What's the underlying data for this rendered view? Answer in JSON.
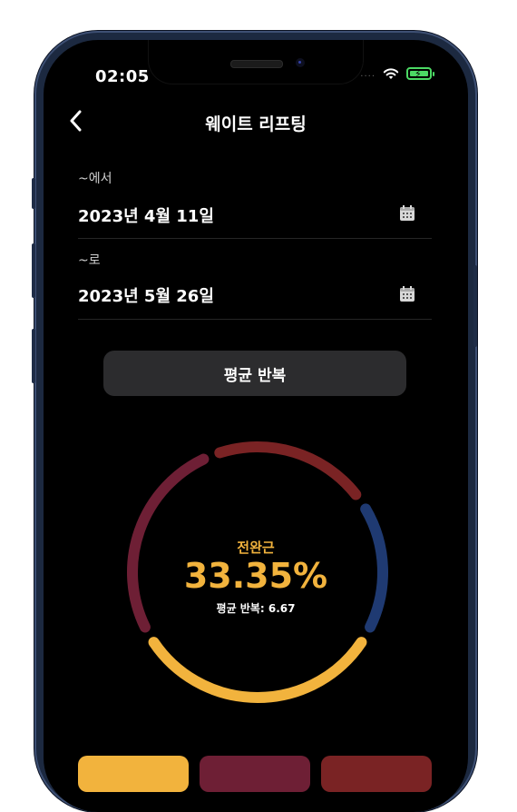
{
  "status_bar": {
    "time": "02:05",
    "dots": "....",
    "wifi_icon": "wifi-icon",
    "battery_icon": "battery-charging-icon"
  },
  "header": {
    "title": "웨이트 리프팅",
    "back_icon": "chevron-left-icon"
  },
  "date_range": {
    "from": {
      "label": "~에서",
      "value": "2023년 4월 11일",
      "icon": "calendar-icon"
    },
    "to": {
      "label": "~로",
      "value": "2023년 5월 26일",
      "icon": "calendar-icon"
    }
  },
  "metric_button": {
    "label": "평균 반복"
  },
  "ring_chart": {
    "center_label": "전완근",
    "center_value": "33.35%",
    "subtitle": "평균 반복: 6.67",
    "segments": [
      {
        "color": "#f2b33d",
        "fraction": 0.3335
      },
      {
        "color": "#6e1f35",
        "fraction": 0.2733
      },
      {
        "color": "#7a2324",
        "fraction": 0.2147
      },
      {
        "color": "#1f3a72",
        "fraction": 0.1785
      }
    ]
  },
  "bottom_tabs": [
    {
      "color": "#f2b33d"
    },
    {
      "color": "#6e1f35"
    },
    {
      "color": "#7a2324"
    }
  ]
}
